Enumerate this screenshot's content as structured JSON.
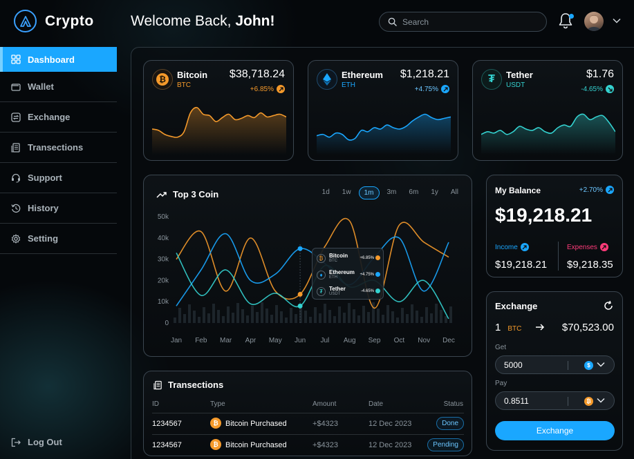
{
  "app": {
    "name": "Crypto",
    "welcome_prefix": "Welcome Back,",
    "user_name": "John!",
    "search_placeholder": "Search"
  },
  "sidebar": {
    "items": [
      {
        "label": "Dashboard",
        "icon": "grid-icon",
        "active": true
      },
      {
        "label": "Wallet",
        "icon": "wallet-icon"
      },
      {
        "label": "Exchange",
        "icon": "exchange-icon"
      },
      {
        "label": "Transections",
        "icon": "receipt-icon"
      },
      {
        "label": "Support",
        "icon": "headset-icon"
      },
      {
        "label": "History",
        "icon": "history-icon"
      },
      {
        "label": "Setting",
        "icon": "gear-icon"
      }
    ],
    "logout": "Log Out"
  },
  "coins": [
    {
      "name": "Bitcoin",
      "symbol": "BTC",
      "price": "$38,718.24",
      "change": "+6.85%",
      "color": "#f59a2b",
      "spark": [
        38,
        36,
        30,
        27,
        26,
        34,
        62,
        70,
        60,
        58,
        49,
        55,
        60,
        52,
        54,
        58,
        55,
        62,
        56,
        58,
        60,
        56
      ]
    },
    {
      "name": "Ethereum",
      "symbol": "ETH",
      "price": "$1,218.21",
      "change": "+4.75%",
      "color": "#1aa7ff",
      "spark": [
        28,
        30,
        26,
        32,
        30,
        22,
        24,
        36,
        34,
        40,
        38,
        44,
        40,
        38,
        42,
        50,
        56,
        60,
        55,
        52,
        54,
        56
      ]
    },
    {
      "name": "Tether",
      "symbol": "USDT",
      "price": "$1.76",
      "change": "-4.65%",
      "color": "#34d2d0",
      "spark": [
        30,
        34,
        32,
        36,
        30,
        34,
        42,
        38,
        36,
        40,
        34,
        32,
        40,
        44,
        42,
        56,
        60,
        52,
        56,
        58,
        48,
        34
      ]
    }
  ],
  "top3": {
    "title": "Top 3 Coin",
    "ranges": [
      "1d",
      "1w",
      "1m",
      "3m",
      "6m",
      "1y",
      "All"
    ],
    "active_range": "1m",
    "tooltip": [
      {
        "name": "Bitcoin",
        "symbol": "BTC",
        "change": "+6.85%",
        "color": "#f59a2b",
        "glyph": "₿"
      },
      {
        "name": "Ethereum",
        "symbol": "ETH",
        "change": "+4.75%",
        "color": "#1aa7ff",
        "glyph": "⬨"
      },
      {
        "name": "Tether",
        "symbol": "USDT",
        "change": "-4.65%",
        "color": "#34d2d0",
        "glyph": "T"
      }
    ]
  },
  "chart_data": {
    "type": "line",
    "title": "Top 3 Coin",
    "categories": [
      "Jan",
      "Feb",
      "Mar",
      "Apr",
      "May",
      "Jun",
      "Jul",
      "Aug",
      "Sep",
      "Oct",
      "Nov",
      "Dec"
    ],
    "y_ticks": [
      "0",
      "10k",
      "20k",
      "30k",
      "40k",
      "50k"
    ],
    "ylim": [
      0,
      50000
    ],
    "grid": false,
    "series": [
      {
        "name": "Bitcoin",
        "color": "#f59a2b",
        "values": [
          30000,
          43000,
          15000,
          40000,
          15000,
          13500,
          36000,
          48000,
          7000,
          46000,
          38000,
          31000
        ]
      },
      {
        "name": "Ethereum",
        "color": "#1aa7ff",
        "values": [
          8000,
          25000,
          42000,
          20000,
          23000,
          35000,
          28000,
          18000,
          31000,
          40000,
          15000,
          38000
        ]
      },
      {
        "name": "Tether",
        "color": "#34d2d0",
        "values": [
          33000,
          13000,
          25000,
          9000,
          14000,
          8000,
          27000,
          17000,
          20000,
          10000,
          20000,
          2000
        ]
      }
    ]
  },
  "balance": {
    "title": "My Balance",
    "change": "+2.70%",
    "amount": "$19,218.21",
    "income_label": "Income",
    "income_value": "$19,218.21",
    "expenses_label": "Expenses",
    "expenses_value": "$9,218.35"
  },
  "exchange": {
    "title": "Exchange",
    "amount": "1",
    "symbol": "BTC",
    "result": "$70,523.00",
    "get_label": "Get",
    "get_value": "5000",
    "get_currency": "$",
    "pay_label": "Pay",
    "pay_value": "0.8511",
    "pay_currency": "₿",
    "button": "Exchange"
  },
  "transactions": {
    "title": "Transections",
    "headers": [
      "ID",
      "Type",
      "Amount",
      "Date",
      "Status"
    ],
    "rows": [
      {
        "id": "1234567",
        "type": "Bitcoin Purchased",
        "amount": "+$4323",
        "date": "12 Dec 2023",
        "status": "Done"
      },
      {
        "id": "1234567",
        "type": "Bitcoin Purchased",
        "amount": "+$4323",
        "date": "12 Dec 2023",
        "status": "Pending"
      }
    ]
  },
  "colors": {
    "accent": "#1aa7ff",
    "bitcoin": "#f59a2b",
    "tether": "#34d2d0",
    "expense": "#ff3b7a"
  }
}
